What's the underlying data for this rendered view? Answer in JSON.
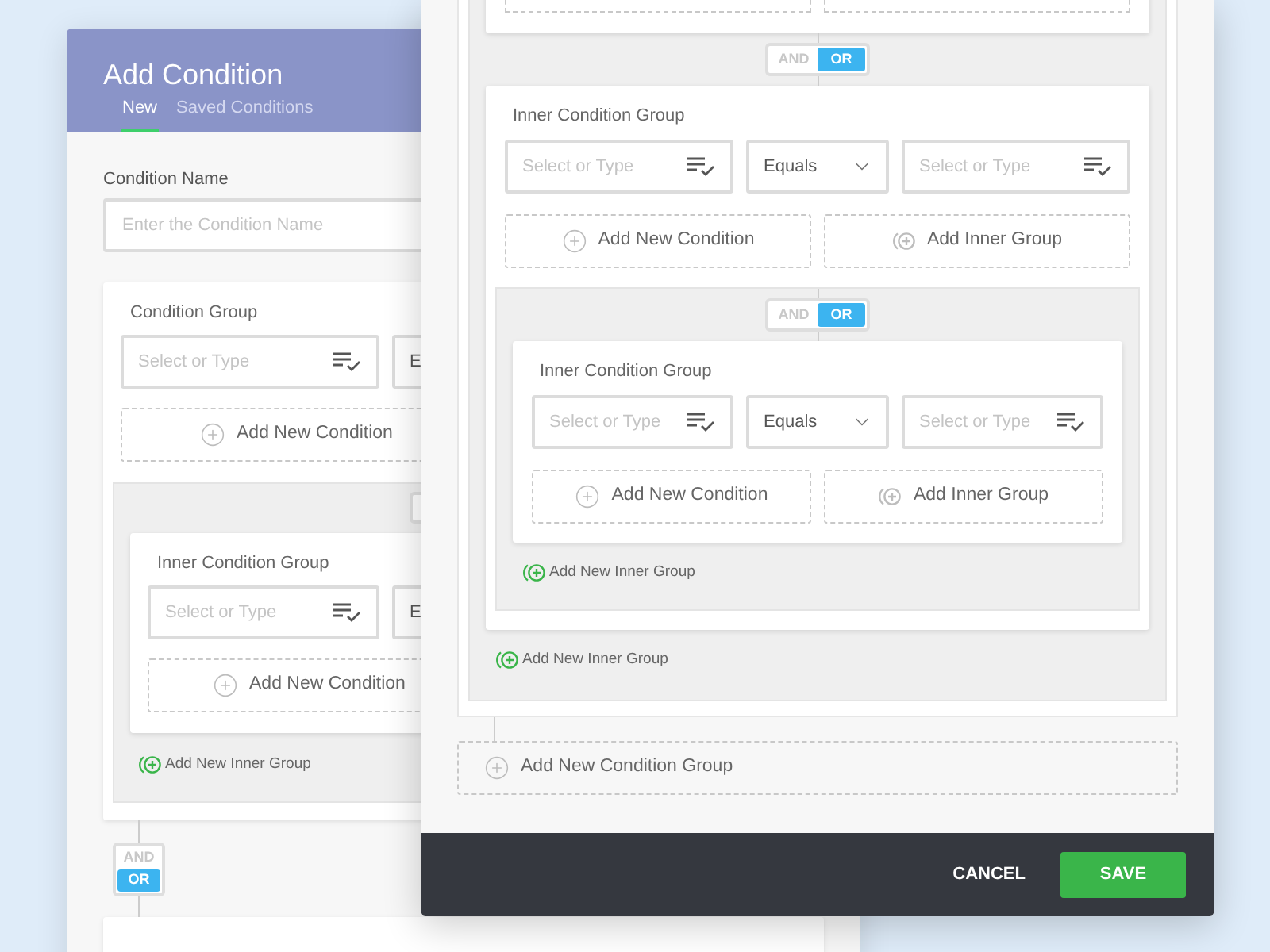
{
  "back_window": {
    "title": "Add Condition",
    "tabs": [
      {
        "label": "New",
        "selected": true
      },
      {
        "label": "Saved Conditions",
        "selected": false
      }
    ],
    "condition_name": {
      "label": "Condition Name",
      "placeholder": "Enter the Condition Name"
    },
    "condition_group": {
      "label": "Condition Group",
      "field": {
        "placeholder": "Select or Type"
      },
      "operator": "E",
      "add_condition": "Add New Condition",
      "inner_group": {
        "label": "Inner Condition Group",
        "field": {
          "placeholder": "Select or Type"
        },
        "operator": "E",
        "add_condition": "Add New Condition"
      },
      "add_inner_group": "Add New Inner Group"
    },
    "connector": [
      {
        "label": "AND",
        "selected": false
      },
      {
        "label": "OR",
        "selected": true
      }
    ]
  },
  "front_window": {
    "top_connector": [
      {
        "label": "AND",
        "selected": false
      },
      {
        "label": "OR",
        "selected": true
      }
    ],
    "inner_group": {
      "label": "Inner Condition Group",
      "left_field": {
        "placeholder": "Select or Type"
      },
      "operator": "Equals",
      "right_field": {
        "placeholder": "Select or Type"
      },
      "add_condition": "Add New Condition",
      "add_inner_group": "Add Inner Group",
      "connector": [
        {
          "label": "AND",
          "selected": false
        },
        {
          "label": "OR",
          "selected": true
        }
      ],
      "nested_group": {
        "label": "Inner Condition Group",
        "left_field": {
          "placeholder": "Select or Type"
        },
        "operator": "Equals",
        "right_field": {
          "placeholder": "Select or Type"
        },
        "add_condition": "Add New Condition",
        "add_inner_group": "Add Inner Group"
      },
      "add_new_inner_group": "Add New Inner Group"
    },
    "add_new_inner_group": "Add New Inner Group",
    "add_condition_group": "Add New Condition Group"
  },
  "footer": {
    "cancel": "CANCEL",
    "save": "SAVE"
  }
}
